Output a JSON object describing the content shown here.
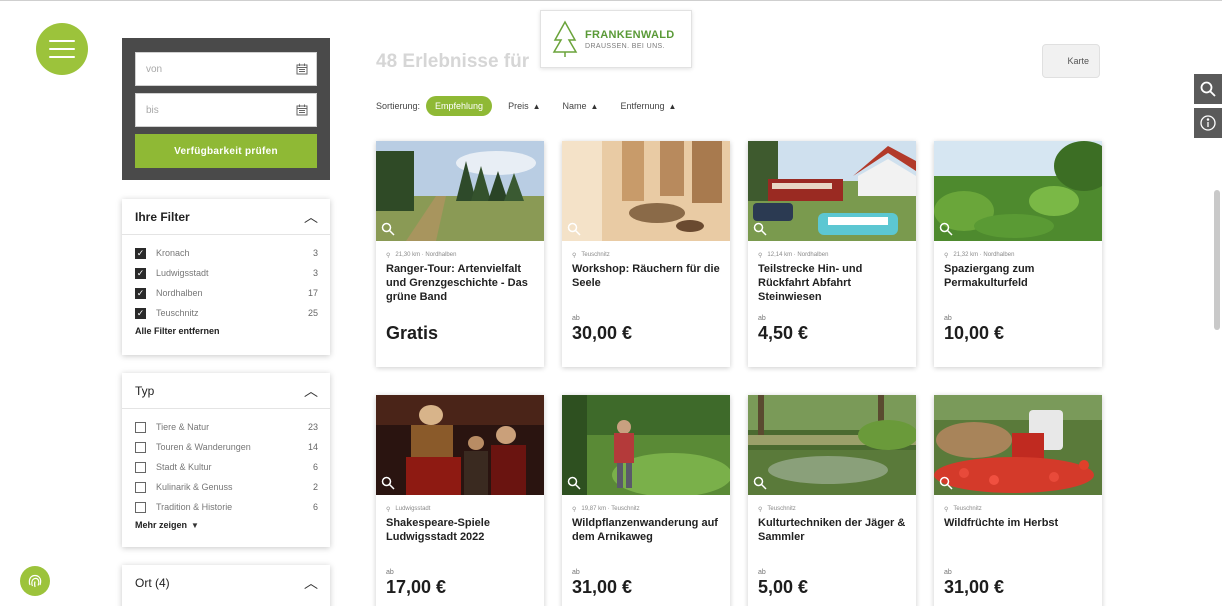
{
  "sidebar": {
    "date_from_placeholder": "von",
    "date_to_placeholder": "bis",
    "check_button": "Verfügbarkeit prüfen",
    "filters_panel": {
      "title": "Ihre Filter",
      "items": [
        {
          "label": "Kronach",
          "count": "3"
        },
        {
          "label": "Ludwigsstadt",
          "count": "3"
        },
        {
          "label": "Nordhalben",
          "count": "17"
        },
        {
          "label": "Teuschnitz",
          "count": "25"
        }
      ],
      "clear_link": "Alle Filter entfernen"
    },
    "type_panel": {
      "title": "Typ",
      "items": [
        {
          "label": "Tiere & Natur",
          "count": "23"
        },
        {
          "label": "Touren & Wanderungen",
          "count": "14"
        },
        {
          "label": "Stadt & Kultur",
          "count": "6"
        },
        {
          "label": "Kulinarik & Genuss",
          "count": "2"
        },
        {
          "label": "Tradition & Historie",
          "count": "6"
        }
      ],
      "more_link": "Mehr zeigen"
    },
    "location_panel": {
      "title": "Ort (4)"
    }
  },
  "header": {
    "heading": "48 Erlebnisse für",
    "logo_brand": "FRANKENWALD",
    "logo_tagline": "DRAUSSEN. BEI UNS.",
    "map_button": "Karte"
  },
  "sort": {
    "label": "Sortierung:",
    "active": "Empfehlung",
    "options": [
      "Preis",
      "Name",
      "Entfernung"
    ]
  },
  "cards": [
    {
      "meta": "21,30 km · Nordhalben",
      "title": "Ranger-Tour: Artenvielfalt und Grenzgeschichte - Das grüne Band",
      "ab": "",
      "price": "Gratis"
    },
    {
      "meta": "Teuschnitz",
      "title": "Workshop: Räuchern für die Seele",
      "ab": "ab",
      "price": "30,00 €"
    },
    {
      "meta": "12,14 km · Nordhalben",
      "title": "Teilstrecke Hin- und Rückfahrt Abfahrt Steinwiesen",
      "ab": "ab",
      "price": "4,50 €"
    },
    {
      "meta": "21,32 km · Nordhalben",
      "title": "Spaziergang zum Permakulturfeld",
      "ab": "ab",
      "price": "10,00 €"
    },
    {
      "meta": "Ludwigsstadt",
      "title": "Shakespeare-Spiele Ludwigsstadt 2022",
      "ab": "ab",
      "price": "17,00 €"
    },
    {
      "meta": "19,87 km · Teuschnitz",
      "title": "Wildpflanzenwanderung auf dem Arnikaweg",
      "ab": "ab",
      "price": "31,00 €"
    },
    {
      "meta": "Teuschnitz",
      "title": "Kulturtechniken der Jäger & Sammler",
      "ab": "ab",
      "price": "5,00 €"
    },
    {
      "meta": "Teuschnitz",
      "title": "Wildfrüchte im Herbst",
      "ab": "ab",
      "price": "31,00 €"
    }
  ],
  "colors": {
    "accent": "#8fb935",
    "dark_box": "#4a4a4a"
  }
}
